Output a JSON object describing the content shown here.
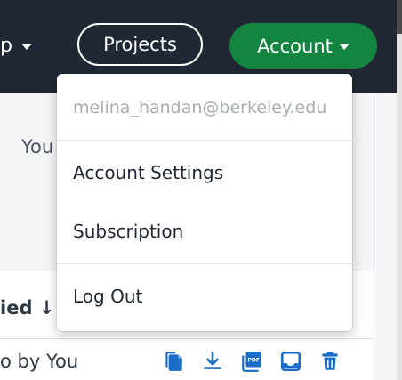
{
  "nav": {
    "help_partial": "p",
    "projects_label": "Projects",
    "account_label": "Account"
  },
  "page": {
    "you_partial": "You",
    "sort_label_partial": "ied ↓",
    "row_owner_partial": "o by You"
  },
  "dropdown": {
    "email": "melina_handan@berkeley.edu",
    "items": [
      {
        "label": "Account Settings"
      },
      {
        "label": "Subscription"
      },
      {
        "label": "Log Out"
      }
    ]
  },
  "row_actions": [
    {
      "icon": "copy-icon"
    },
    {
      "icon": "download-icon"
    },
    {
      "icon": "pdf-icon"
    },
    {
      "icon": "archive-icon"
    },
    {
      "icon": "trash-icon"
    }
  ],
  "colors": {
    "nav_bg": "#1f2834",
    "accent_green": "#148541",
    "icon_blue": "#1a6ec7"
  }
}
